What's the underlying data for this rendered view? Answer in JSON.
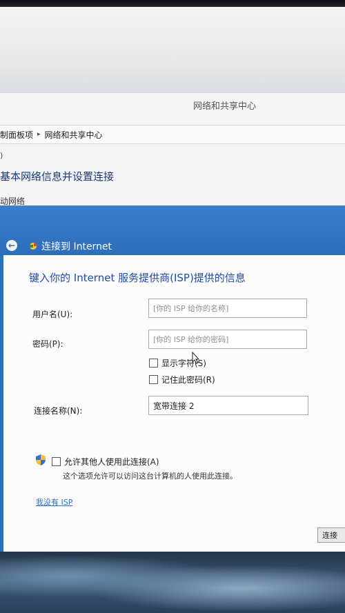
{
  "window": {
    "title": "网络和共享中心"
  },
  "breadcrumb": {
    "items": [
      "制面板项",
      "网络和共享中心"
    ]
  },
  "background": {
    "paren": ")",
    "heading": "基本网络信息并设置连接",
    "sub": "动网络"
  },
  "dialog": {
    "title": "连接到 Internet",
    "instruction": "键入你的 Internet 服务提供商(ISP)提供的信息",
    "username": {
      "label": "用户名(U):",
      "placeholder": "[你的 ISP 给你的名称]"
    },
    "password": {
      "label": "密码(P):",
      "placeholder": "[你的 ISP 给你的密码]"
    },
    "show_chars": "显示字符(S)",
    "remember_pw": "记住此密码(R)",
    "connection_name": {
      "label": "连接名称(N):",
      "value": "宽带连接 2"
    },
    "allow_others": "允许其他人使用此连接(A)",
    "allow_desc": "这个选项允许可以访问这台计算机的人使用此连接。",
    "no_isp_link": "我没有 ISP",
    "connect_button": "连接"
  },
  "colors": {
    "accent": "#2b6fbd",
    "instruction_text": "#1f4aa8",
    "link": "#2a6fd6"
  },
  "icons": [
    "back-arrow-icon",
    "network-icon",
    "uac-shield-icon",
    "mouse-cursor-icon"
  ]
}
